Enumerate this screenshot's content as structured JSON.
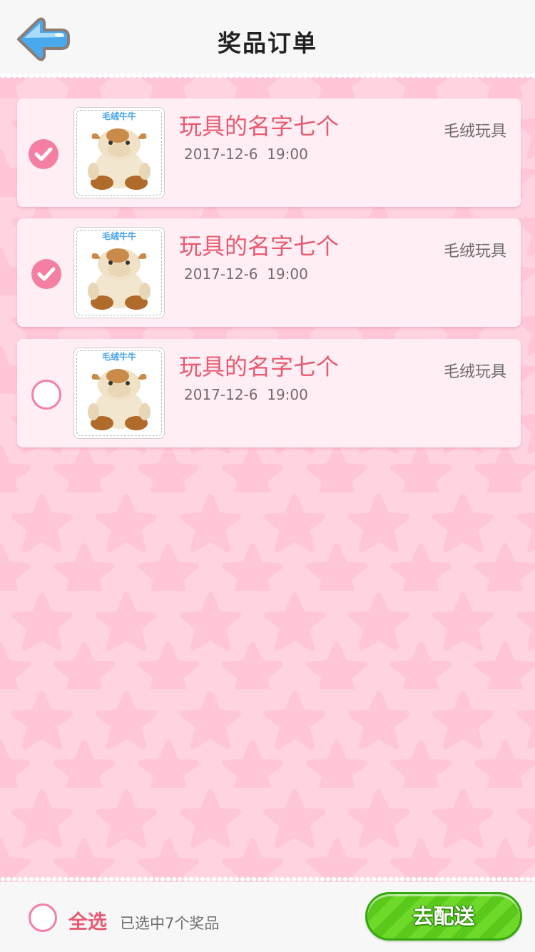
{
  "header": {
    "title": "奖品订单",
    "back_icon": "arrow-left-icon"
  },
  "orders": [
    {
      "selected": true,
      "thumb_label": "毛绒牛牛",
      "name": "玩具的名字七个",
      "date": "2017-12-6  19:00",
      "category": "毛绒玩具"
    },
    {
      "selected": true,
      "thumb_label": "毛绒牛牛",
      "name": "玩具的名字七个",
      "date": "2017-12-6  19:00",
      "category": "毛绒玩具"
    },
    {
      "selected": false,
      "thumb_label": "毛绒牛牛",
      "name": "玩具的名字七个",
      "date": "2017-12-6  19:00",
      "category": "毛绒玩具"
    }
  ],
  "footer": {
    "select_all_label": "全选",
    "selected_info": "已选中7个奖品",
    "deliver_button": "去配送"
  },
  "colors": {
    "accent_pink": "#f57fa3",
    "title_red": "#e85a72",
    "button_green": "#5bc81c",
    "background_pink": "#ffd3e0"
  }
}
